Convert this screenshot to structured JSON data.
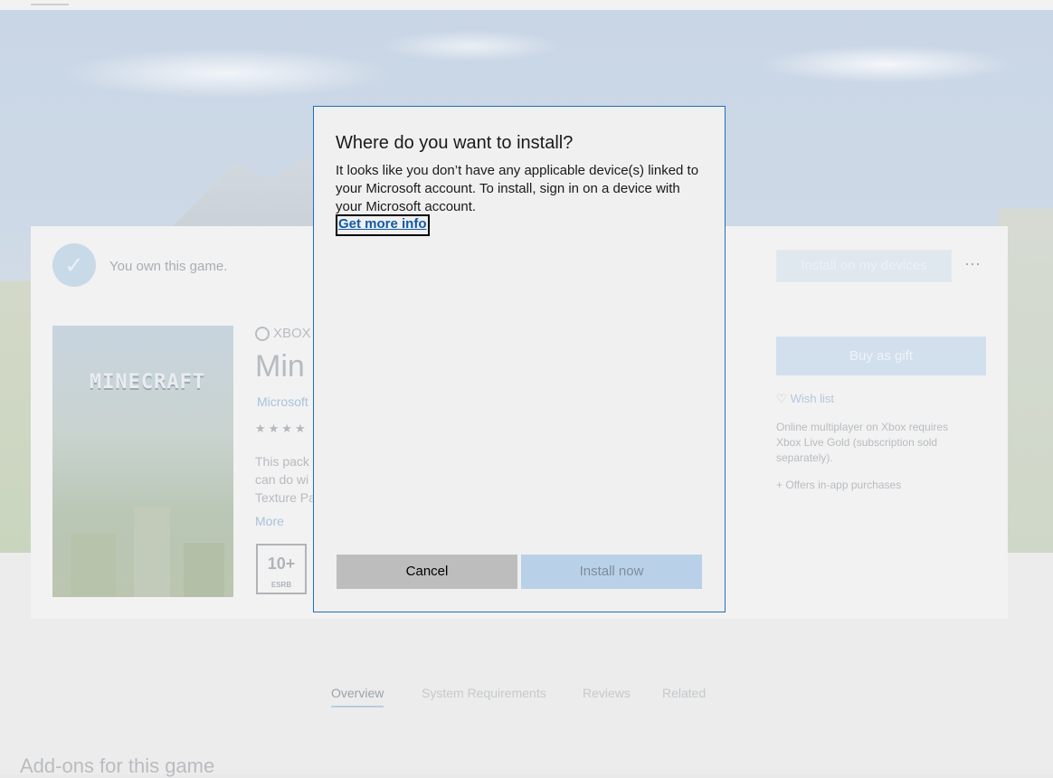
{
  "background": {
    "own_text": "You own this game.",
    "install_button": "Install on my devices",
    "more_menu": "···",
    "boxart_logo": "MINECRAFT",
    "xbox_label": "XBOX",
    "title_partial": "Min",
    "publisher_partial": "Microsoft",
    "stars": "★★★★",
    "description_lines": [
      "This pack",
      "can do wi",
      "Texture Pa"
    ],
    "more_link": "More",
    "esrb_rating": "10+",
    "esrb_label": "ESRB",
    "gift_button": "Buy as gift",
    "wish_list": "Wish list",
    "online_note": "Online multiplayer on Xbox requires Xbox Live Gold (subscription sold separately).",
    "offers_note": "+ Offers in-app purchases",
    "tabs": [
      "Overview",
      "System Requirements",
      "Reviews",
      "Related"
    ],
    "addons_heading": "Add-ons for this game"
  },
  "dialog": {
    "title": "Where do you want to install?",
    "body": "It looks like you don’t have any applicable device(s) linked to your Microsoft account. To install, sign in on a device with your Microsoft account.",
    "link": "Get more info",
    "cancel_label": "Cancel",
    "install_label": "Install now"
  },
  "colors": {
    "dialog_border": "#1f6ebf",
    "link": "#0f5aa8",
    "cancel_bg": "#bdbdbd",
    "install_bg_disabled": "#b9d1e8"
  }
}
